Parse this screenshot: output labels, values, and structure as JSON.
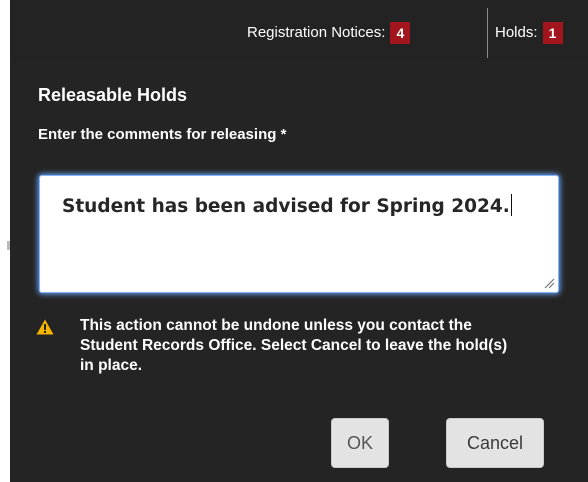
{
  "header": {
    "registration_label": "Registration Notices:",
    "registration_count": "4",
    "holds_label": "Holds:",
    "holds_count": "1"
  },
  "dialog": {
    "title": "Releasable Holds",
    "field_label": "Enter the comments for releasing *",
    "comment_value": "Student has been advised for Spring 2024.",
    "warning_text": "This action cannot be undone unless you contact the Student Records Office. Select Cancel to leave the hold(s) in place.",
    "ok_label": "OK",
    "cancel_label": "Cancel"
  },
  "colors": {
    "badge": "#a3151c",
    "panel": "#242424",
    "focus_glow": "#6aa8ff",
    "warning": "#f5b400"
  },
  "icons": {
    "warning": "warning-triangle-icon",
    "resize": "resize-handle-icon"
  }
}
